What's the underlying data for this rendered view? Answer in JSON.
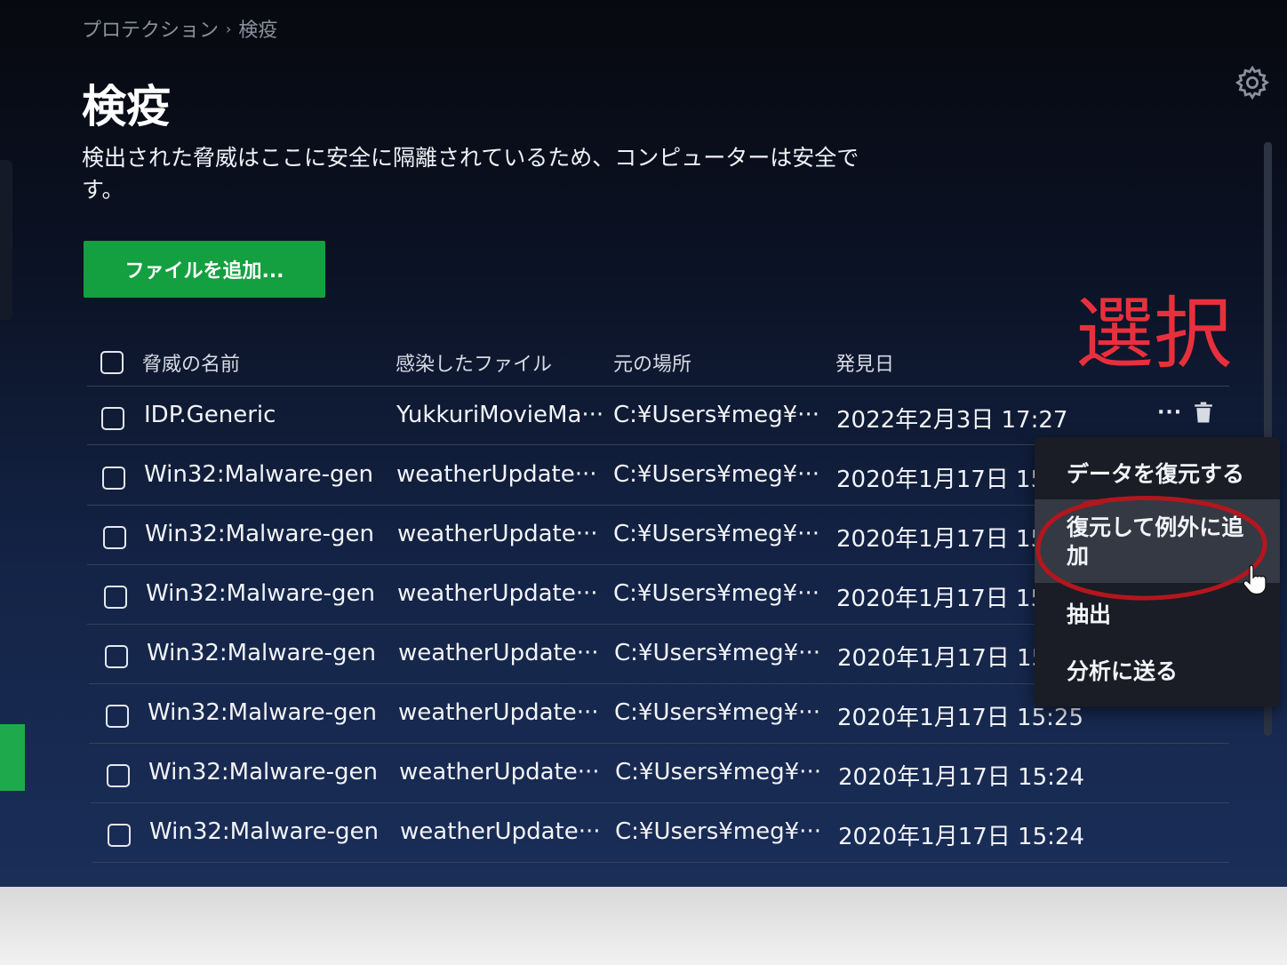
{
  "breadcrumb": {
    "parent": "プロテクション",
    "separator": "›",
    "current": "検疫"
  },
  "page": {
    "title": "検疫",
    "description": "検出された脅威はここに安全に隔離されているため、コンピューターは安全です。",
    "add_button": "ファイルを追加..."
  },
  "annotation": {
    "text": "選択",
    "color": "#e8303c"
  },
  "table": {
    "headers": [
      "脅威の名前",
      "感染したファイル",
      "元の場所",
      "発見日"
    ],
    "rows": [
      {
        "name": "IDP.Generic",
        "file": "YukkuriMovieMa···",
        "location": "C:¥Users¥meg¥···",
        "date": "2022年2月3日 17:27"
      },
      {
        "name": "Win32:Malware-gen",
        "file": "weatherUpdate···",
        "location": "C:¥Users¥meg¥···",
        "date": "2020年1月17日 15"
      },
      {
        "name": "Win32:Malware-gen",
        "file": "weatherUpdate···",
        "location": "C:¥Users¥meg¥···",
        "date": "2020年1月17日 15"
      },
      {
        "name": "Win32:Malware-gen",
        "file": "weatherUpdate···",
        "location": "C:¥Users¥meg¥···",
        "date": "2020年1月17日 15"
      },
      {
        "name": "Win32:Malware-gen",
        "file": "weatherUpdate···",
        "location": "C:¥Users¥meg¥···",
        "date": "2020年1月17日 15"
      },
      {
        "name": "Win32:Malware-gen",
        "file": "weatherUpdate···",
        "location": "C:¥Users¥meg¥···",
        "date": "2020年1月17日 15:25"
      },
      {
        "name": "Win32:Malware-gen",
        "file": "weatherUpdate···",
        "location": "C:¥Users¥meg¥···",
        "date": "2020年1月17日 15:24"
      },
      {
        "name": "Win32:Malware-gen",
        "file": "weatherUpdate···",
        "location": "C:¥Users¥meg¥···",
        "date": "2020年1月17日 15:24"
      }
    ],
    "row_actions": {
      "more": "···"
    }
  },
  "context_menu": {
    "items": [
      "データを復元する",
      "復元して例外に追加",
      "抽出",
      "分析に送る"
    ],
    "highlighted_index": 1
  },
  "colors": {
    "accent_green": "#14a040",
    "menu_bg": "#1a1d25",
    "menu_hover": "#353943"
  }
}
